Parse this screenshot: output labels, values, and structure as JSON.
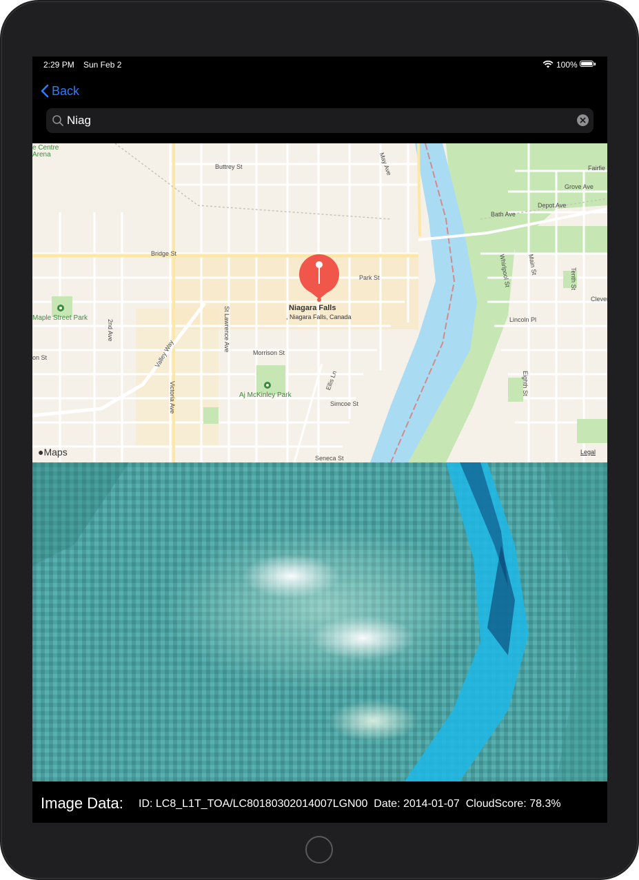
{
  "status_bar": {
    "time": "2:29 PM",
    "date": "Sun Feb 2",
    "battery": "100%"
  },
  "nav": {
    "back_label": "Back"
  },
  "search": {
    "value": "Niag"
  },
  "map": {
    "pin_title": "Niagara Falls",
    "pin_subtitle": ", Niagara Falls, Canada",
    "streets": [
      "Buttrey St",
      "Bridge St",
      "Park St",
      "2nd Ave",
      "St Lawrence Ave",
      "Valley Way",
      "Victoria Ave",
      "Morrison St",
      "Ellis Ln",
      "Simcoe St",
      "Seneca St",
      "Bath Ave",
      "Grove Ave",
      "Depot Ave",
      "Whirlpool St",
      "Main St",
      "Tenth St",
      "Lincoln Pl",
      "Eighth St",
      "May Ave",
      "Fairfie",
      "Clever",
      "on St"
    ],
    "parks": [
      "Maple Street Park",
      "Aj McKinley Park"
    ],
    "corner_label": "e Centre\nArena",
    "attribution": "Maps",
    "legal": "Legal",
    "colors": {
      "water": "#a9dcf2",
      "green": "#c6e6b4",
      "land": "#f6f1e8",
      "pin": "#f0574a"
    }
  },
  "image_data": {
    "title": "Image Data:",
    "id_label": "ID: ",
    "id": "LC8_L1T_TOA/LC80180302014007LGN00",
    "date_label": "Date: ",
    "date": "2014-01-07",
    "cloud_label": "CloudScore: ",
    "cloud_score": "78.3%"
  }
}
